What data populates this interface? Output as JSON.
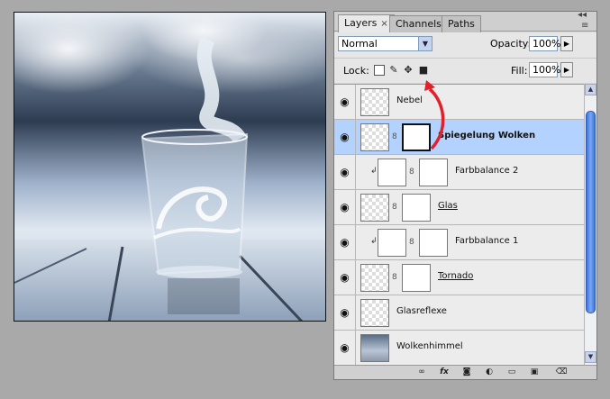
{
  "panel": {
    "tabs": [
      {
        "label": "Layers",
        "close": "×"
      },
      {
        "label": "Channels"
      },
      {
        "label": "Paths"
      }
    ],
    "controls": {
      "collapse": "◂◂",
      "menu": "≡"
    },
    "blend_mode": "Normal",
    "opacity_label": "Opacity:",
    "opacity_value": "100%",
    "lock_label": "Lock:",
    "fill_label": "Fill:",
    "fill_value": "100%"
  },
  "layers": [
    {
      "name": "Nebel",
      "visible": true,
      "thumb": "transparent"
    },
    {
      "name": "Spiegelung Wolken",
      "visible": true,
      "thumb": "transparent",
      "mask": true,
      "selected": true
    },
    {
      "name": "Farbbalance 2",
      "visible": true,
      "thumb": "adjustment",
      "mask": true,
      "clipped": true
    },
    {
      "name": "Glas",
      "visible": true,
      "thumb": "transparent",
      "mask": true
    },
    {
      "name": "Farbbalance 1",
      "visible": true,
      "thumb": "adjustment",
      "mask": true,
      "clipped": true
    },
    {
      "name": "Tornado",
      "visible": true,
      "thumb": "transparent",
      "mask": true
    },
    {
      "name": "Glasreflexe",
      "visible": true,
      "thumb": "transparent"
    },
    {
      "name": "Wolkenhimmel",
      "visible": true,
      "thumb": "photo"
    }
  ],
  "icons": {
    "eye": "👁",
    "chain": "⛓",
    "clip": "↲"
  },
  "colors": {
    "selection": "#b3d2ff",
    "annotation_arrow": "#e0202a",
    "scrollbar": "#3f74d6"
  }
}
